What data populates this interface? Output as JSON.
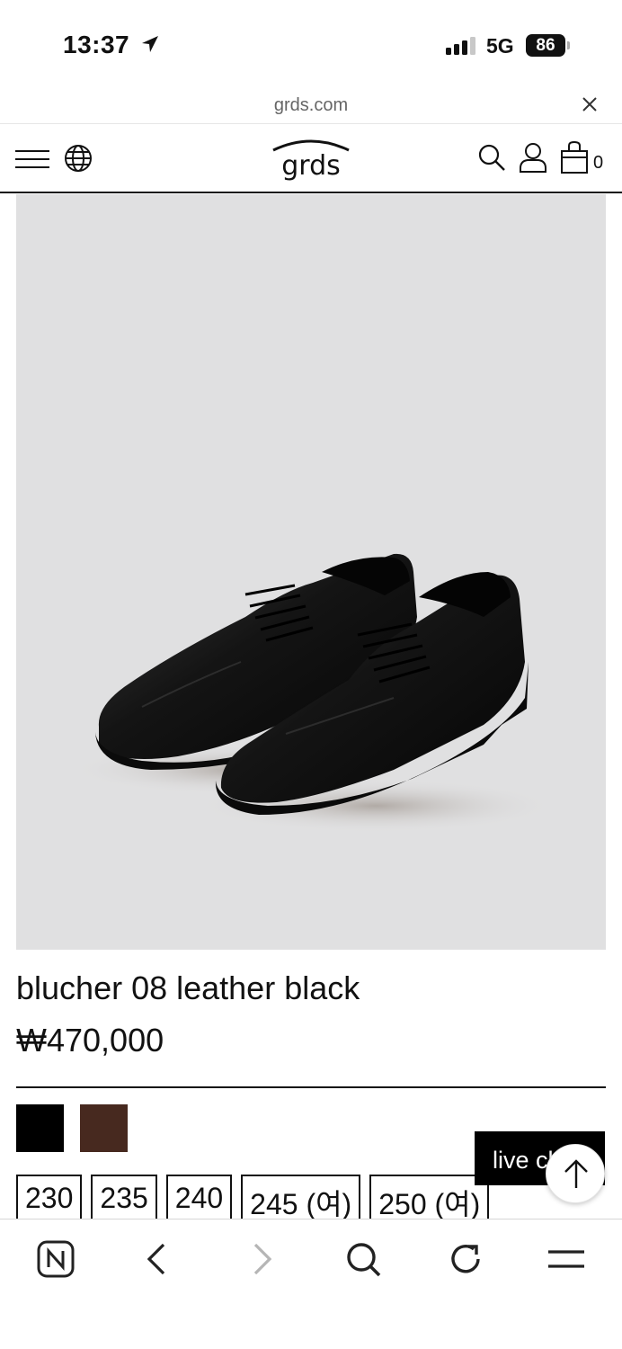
{
  "status": {
    "time": "13:37",
    "network": "5G",
    "battery": "86"
  },
  "browser": {
    "url": "grds.com"
  },
  "header": {
    "logo": "grds",
    "cart_count": "0"
  },
  "product": {
    "name": "blucher 08 leather black",
    "price": "₩470,000",
    "colors": [
      {
        "name": "black",
        "hex": "#000000"
      },
      {
        "name": "brown",
        "hex": "#47291f"
      }
    ],
    "sizes": [
      "230",
      "235",
      "240",
      "245 (여)",
      "250 (여)"
    ]
  },
  "live_chat": {
    "label": "live chat"
  },
  "icons": {
    "status": [
      "location-arrow-icon",
      "signal-icon",
      "battery-icon"
    ],
    "header": [
      "menu-icon",
      "globe-icon",
      "search-icon",
      "account-icon",
      "cart-icon"
    ],
    "toolbar": [
      "naver-icon",
      "back-icon",
      "forward-icon",
      "search-icon",
      "refresh-icon",
      "menu-icon"
    ]
  }
}
